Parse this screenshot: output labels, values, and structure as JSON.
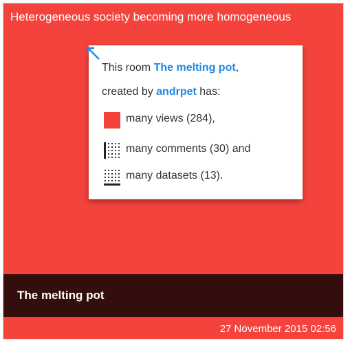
{
  "card": {
    "title": "Heterogeneous society becoming more homogeneous",
    "footer_title": "The melting pot",
    "date": "27 November 2015 02:56"
  },
  "info": {
    "line1_prefix": "This room ",
    "room_name": "The melting pot",
    "line1_suffix": ",",
    "line2_prefix": "created by ",
    "creator": "andrpet",
    "line2_suffix": " has:",
    "views_label": "many views",
    "views_count": "284",
    "comments_label": "many comments",
    "comments_count": "30",
    "comments_suffix": " and",
    "datasets_label": "many datasets",
    "datasets_count": "13"
  },
  "colors": {
    "card_bg": "#f4433c",
    "footer_bg": "#330e0c",
    "link": "#1e88e5"
  },
  "icons": {
    "views": "red-square-icon",
    "comments": "dotted-grid-bar-icon",
    "datasets": "dotted-grid-icon",
    "arrow": "arrow-up-left-icon"
  }
}
